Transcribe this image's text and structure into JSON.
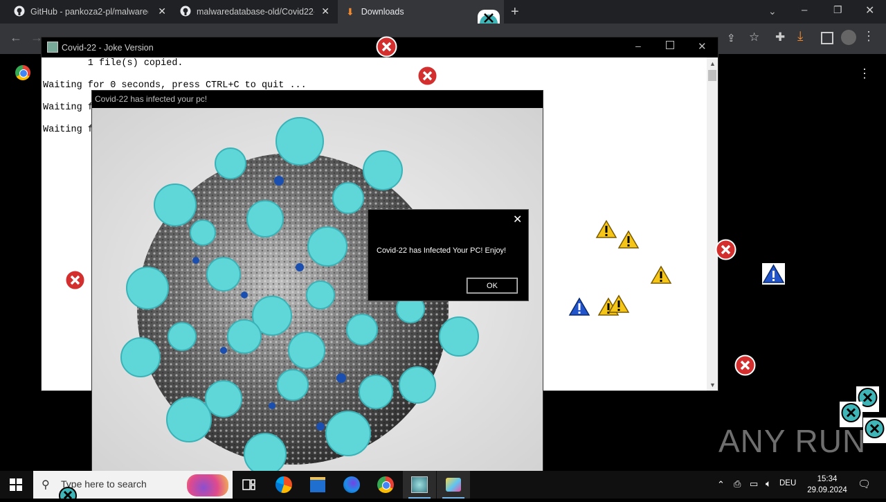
{
  "browser": {
    "tabs": [
      {
        "title": "GitHub - pankoza2-pl/malwared"
      },
      {
        "title": "malwaredatabase-old/Covid22-"
      },
      {
        "title": "Downloads"
      }
    ],
    "address_fragment": "Chrome"
  },
  "console_window": {
    "title": "Covid-22 - Joke Version",
    "lines": [
      "        1 file(s) copied.",
      "Waiting for 0 seconds, press CTRL+C to quit ...",
      "Waiting f",
      "Waiting f"
    ]
  },
  "image_window": {
    "title": "Covid-22 has infected your pc!"
  },
  "message_box": {
    "text": "Covid-22 has Infected Your PC! Enjoy!",
    "ok_label": "OK"
  },
  "taskbar": {
    "search_placeholder": "Type here to search",
    "language": "DEU",
    "time": "15:34",
    "date": "29.09.2024"
  },
  "watermark": "ANY RUN",
  "colors": {
    "error_red": "#d32f2f",
    "warning_yellow": "#f5c518",
    "info_blue": "#2255cc",
    "virus_cyan": "#5fd6d8"
  }
}
